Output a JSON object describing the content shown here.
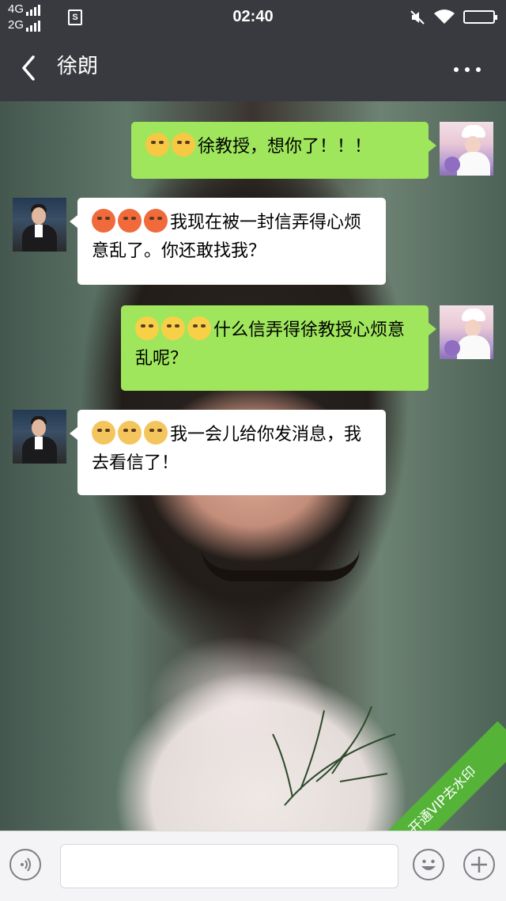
{
  "status_bar": {
    "network_top": "4G",
    "network_bottom": "2G",
    "sim_label": "S",
    "time": "02:40",
    "icons": [
      "mute-icon",
      "wifi-icon",
      "battery-icon"
    ]
  },
  "header": {
    "title": "徐朗",
    "back_icon": "chevron-left-icon",
    "more_icon": "more-dots-icon"
  },
  "messages": [
    {
      "sender": "me",
      "emoji": [
        "tired-face",
        "tired-face"
      ],
      "text": "徐教授，想你了！！！"
    },
    {
      "sender": "them",
      "emoji": [
        "angry-face",
        "angry-face",
        "angry-face"
      ],
      "text": "我现在被一封信弄得心烦意乱了。你还敢找我？"
    },
    {
      "sender": "me",
      "emoji": [
        "sweat-face",
        "sweat-face",
        "sweat-face"
      ],
      "text": "什么信弄得徐教授心烦意乱呢？"
    },
    {
      "sender": "them",
      "emoji": [
        "sad-face",
        "sad-face",
        "sad-face"
      ],
      "text": "我一会儿给你发消息，我去看信了！"
    }
  ],
  "watermark": "开通VIP去水印",
  "input_bar": {
    "voice_icon": "voice-icon",
    "input_value": "",
    "emoji_icon": "emoji-icon",
    "plus_icon": "plus-icon"
  },
  "colors": {
    "bar_bg": "#393a3f",
    "my_bubble": "#9fe65c",
    "their_bubble": "#ffffff",
    "watermark": "#55b338"
  }
}
